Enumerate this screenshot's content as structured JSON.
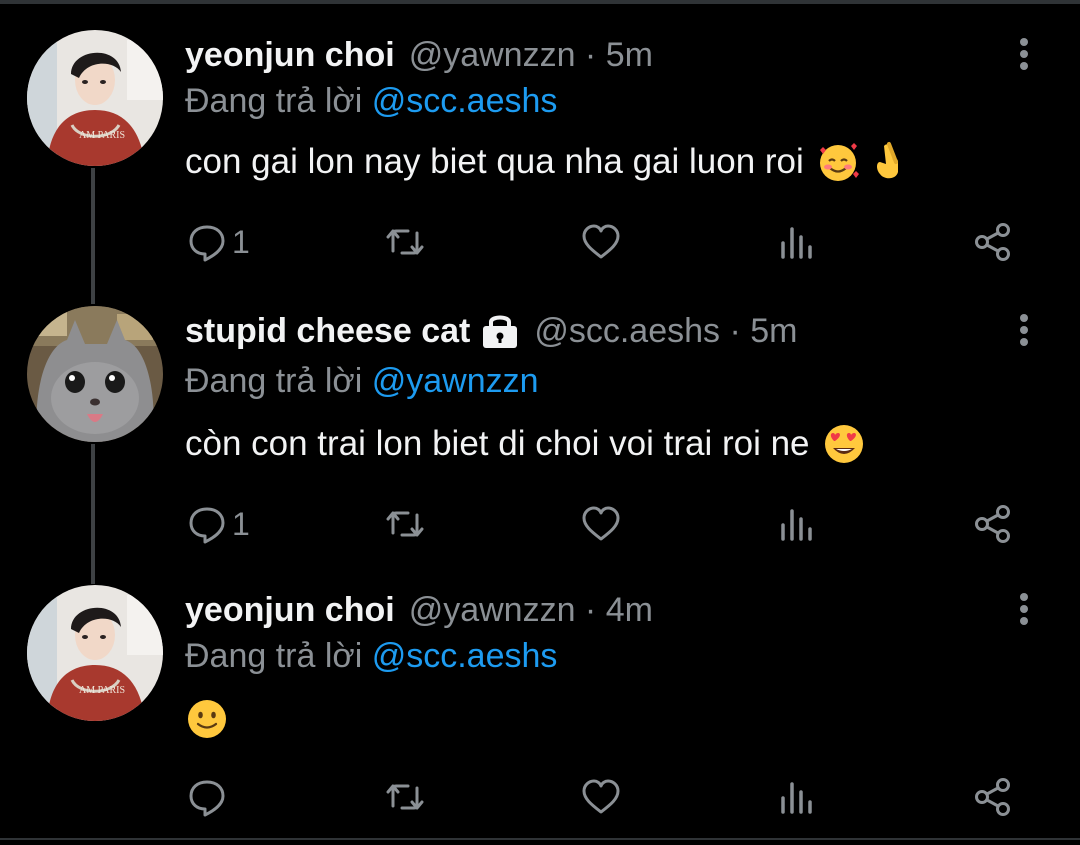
{
  "tweets": [
    {
      "name": "yeonjun choi",
      "handle": "@yawnzzn · 5m",
      "reply_prefix": "Đang trả lời",
      "reply_to": "@scc.aeshs",
      "text": "con gai lon nay biet qua nha gai luon roi",
      "emojis": [
        "smiling-face-with-hearts",
        "hand-with-index-and-middle-fingers-crossed"
      ],
      "reply_count": "1",
      "avatar": "profile-photo-red-sweatshirt",
      "protected": false
    },
    {
      "name": "stupid cheese cat",
      "handle": "@scc.aeshs · 5m",
      "reply_prefix": "Đang trả lời",
      "reply_to": "@yawnzzn",
      "text": "còn con trai lon biet di choi voi trai roi ne",
      "emojis": [
        "smiling-face-with-heart-eyes"
      ],
      "reply_count": "1",
      "avatar": "gray-cat-photo",
      "protected": true
    },
    {
      "name": "yeonjun choi",
      "handle": "@yawnzzn · 4m",
      "reply_prefix": "Đang trả lời",
      "reply_to": "@scc.aeshs",
      "text": "",
      "emojis": [
        "slightly-smiling-face"
      ],
      "reply_count": "",
      "avatar": "profile-photo-red-sweatshirt",
      "protected": false
    }
  ],
  "colors": {
    "background": "#000000",
    "text": "#f2f3f4",
    "secondary": "#8b9095",
    "link": "#1d9bf0"
  }
}
